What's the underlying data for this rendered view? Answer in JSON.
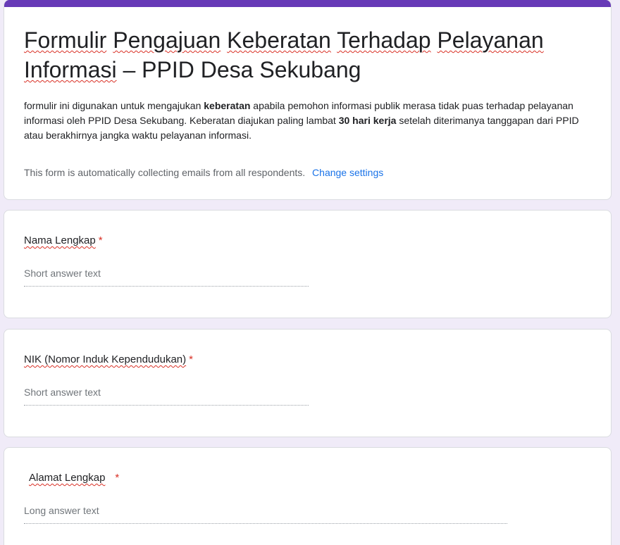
{
  "header": {
    "title_words": [
      "Formulir",
      "Pengajuan",
      "Keberatan",
      "Terhadap",
      "Pelayanan",
      "Informasi",
      "–",
      "PPID",
      "Desa",
      "Sekubang"
    ],
    "description": {
      "part1": "formulir ini digunakan untuk mengajukan ",
      "bold1": "keberatan",
      "part2": " apabila pemohon informasi publik merasa tidak puas terhadap pelayanan informasi oleh PPID Desa Sekubang. Keberatan diajukan paling lambat ",
      "bold2": "30 hari kerja",
      "part3": " setelah diterimanya tanggapan dari PPID atau berakhirnya jangka waktu pelayanan informasi."
    },
    "email_notice": "This form is automatically collecting emails from all respondents.",
    "change_settings_label": "Change settings",
    "accent_color": "#673ab7"
  },
  "questions": [
    {
      "title": "Nama Lengkap",
      "required_mark": "*",
      "placeholder": "Short answer text"
    },
    {
      "title": "NIK (Nomor Induk Kependudukan)",
      "required_mark": "*",
      "placeholder": "Short answer text"
    },
    {
      "title": "Alamat Lengkap",
      "required_mark": "*",
      "placeholder": "Long answer text"
    }
  ]
}
